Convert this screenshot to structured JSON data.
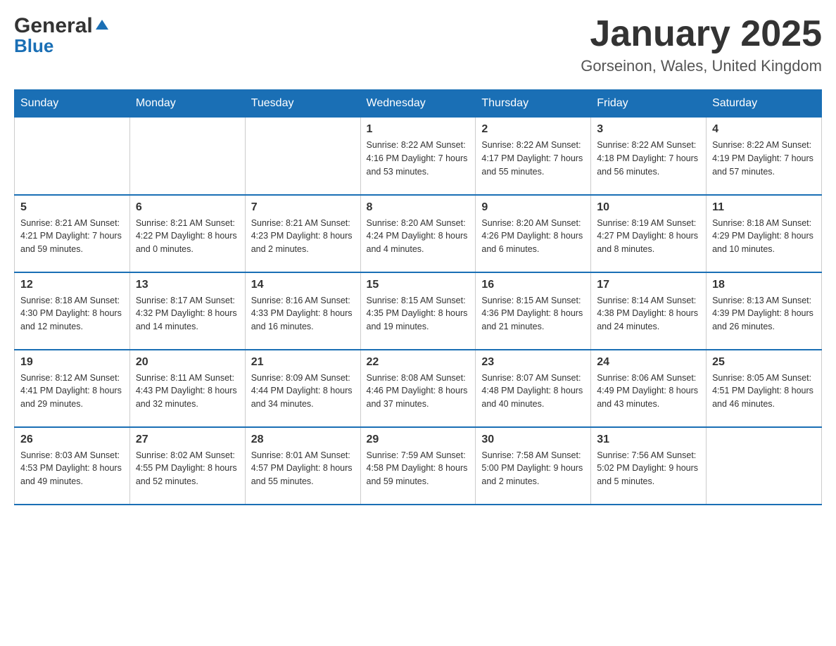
{
  "header": {
    "logo_general": "General",
    "logo_blue": "Blue",
    "month_title": "January 2025",
    "location": "Gorseinon, Wales, United Kingdom"
  },
  "weekdays": [
    "Sunday",
    "Monday",
    "Tuesday",
    "Wednesday",
    "Thursday",
    "Friday",
    "Saturday"
  ],
  "weeks": [
    [
      {
        "day": "",
        "info": ""
      },
      {
        "day": "",
        "info": ""
      },
      {
        "day": "",
        "info": ""
      },
      {
        "day": "1",
        "info": "Sunrise: 8:22 AM\nSunset: 4:16 PM\nDaylight: 7 hours\nand 53 minutes."
      },
      {
        "day": "2",
        "info": "Sunrise: 8:22 AM\nSunset: 4:17 PM\nDaylight: 7 hours\nand 55 minutes."
      },
      {
        "day": "3",
        "info": "Sunrise: 8:22 AM\nSunset: 4:18 PM\nDaylight: 7 hours\nand 56 minutes."
      },
      {
        "day": "4",
        "info": "Sunrise: 8:22 AM\nSunset: 4:19 PM\nDaylight: 7 hours\nand 57 minutes."
      }
    ],
    [
      {
        "day": "5",
        "info": "Sunrise: 8:21 AM\nSunset: 4:21 PM\nDaylight: 7 hours\nand 59 minutes."
      },
      {
        "day": "6",
        "info": "Sunrise: 8:21 AM\nSunset: 4:22 PM\nDaylight: 8 hours\nand 0 minutes."
      },
      {
        "day": "7",
        "info": "Sunrise: 8:21 AM\nSunset: 4:23 PM\nDaylight: 8 hours\nand 2 minutes."
      },
      {
        "day": "8",
        "info": "Sunrise: 8:20 AM\nSunset: 4:24 PM\nDaylight: 8 hours\nand 4 minutes."
      },
      {
        "day": "9",
        "info": "Sunrise: 8:20 AM\nSunset: 4:26 PM\nDaylight: 8 hours\nand 6 minutes."
      },
      {
        "day": "10",
        "info": "Sunrise: 8:19 AM\nSunset: 4:27 PM\nDaylight: 8 hours\nand 8 minutes."
      },
      {
        "day": "11",
        "info": "Sunrise: 8:18 AM\nSunset: 4:29 PM\nDaylight: 8 hours\nand 10 minutes."
      }
    ],
    [
      {
        "day": "12",
        "info": "Sunrise: 8:18 AM\nSunset: 4:30 PM\nDaylight: 8 hours\nand 12 minutes."
      },
      {
        "day": "13",
        "info": "Sunrise: 8:17 AM\nSunset: 4:32 PM\nDaylight: 8 hours\nand 14 minutes."
      },
      {
        "day": "14",
        "info": "Sunrise: 8:16 AM\nSunset: 4:33 PM\nDaylight: 8 hours\nand 16 minutes."
      },
      {
        "day": "15",
        "info": "Sunrise: 8:15 AM\nSunset: 4:35 PM\nDaylight: 8 hours\nand 19 minutes."
      },
      {
        "day": "16",
        "info": "Sunrise: 8:15 AM\nSunset: 4:36 PM\nDaylight: 8 hours\nand 21 minutes."
      },
      {
        "day": "17",
        "info": "Sunrise: 8:14 AM\nSunset: 4:38 PM\nDaylight: 8 hours\nand 24 minutes."
      },
      {
        "day": "18",
        "info": "Sunrise: 8:13 AM\nSunset: 4:39 PM\nDaylight: 8 hours\nand 26 minutes."
      }
    ],
    [
      {
        "day": "19",
        "info": "Sunrise: 8:12 AM\nSunset: 4:41 PM\nDaylight: 8 hours\nand 29 minutes."
      },
      {
        "day": "20",
        "info": "Sunrise: 8:11 AM\nSunset: 4:43 PM\nDaylight: 8 hours\nand 32 minutes."
      },
      {
        "day": "21",
        "info": "Sunrise: 8:09 AM\nSunset: 4:44 PM\nDaylight: 8 hours\nand 34 minutes."
      },
      {
        "day": "22",
        "info": "Sunrise: 8:08 AM\nSunset: 4:46 PM\nDaylight: 8 hours\nand 37 minutes."
      },
      {
        "day": "23",
        "info": "Sunrise: 8:07 AM\nSunset: 4:48 PM\nDaylight: 8 hours\nand 40 minutes."
      },
      {
        "day": "24",
        "info": "Sunrise: 8:06 AM\nSunset: 4:49 PM\nDaylight: 8 hours\nand 43 minutes."
      },
      {
        "day": "25",
        "info": "Sunrise: 8:05 AM\nSunset: 4:51 PM\nDaylight: 8 hours\nand 46 minutes."
      }
    ],
    [
      {
        "day": "26",
        "info": "Sunrise: 8:03 AM\nSunset: 4:53 PM\nDaylight: 8 hours\nand 49 minutes."
      },
      {
        "day": "27",
        "info": "Sunrise: 8:02 AM\nSunset: 4:55 PM\nDaylight: 8 hours\nand 52 minutes."
      },
      {
        "day": "28",
        "info": "Sunrise: 8:01 AM\nSunset: 4:57 PM\nDaylight: 8 hours\nand 55 minutes."
      },
      {
        "day": "29",
        "info": "Sunrise: 7:59 AM\nSunset: 4:58 PM\nDaylight: 8 hours\nand 59 minutes."
      },
      {
        "day": "30",
        "info": "Sunrise: 7:58 AM\nSunset: 5:00 PM\nDaylight: 9 hours\nand 2 minutes."
      },
      {
        "day": "31",
        "info": "Sunrise: 7:56 AM\nSunset: 5:02 PM\nDaylight: 9 hours\nand 5 minutes."
      },
      {
        "day": "",
        "info": ""
      }
    ]
  ]
}
